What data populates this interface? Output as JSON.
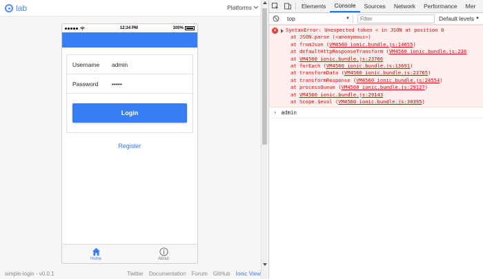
{
  "lab": {
    "logo_text": "lab",
    "platforms_label": "Platforms",
    "footer": {
      "version": "simple-login - v0.0.1",
      "links": [
        "Twitter",
        "Documentation",
        "Forum",
        "GitHub",
        "Ionic View"
      ]
    }
  },
  "phone": {
    "status": {
      "time": "12:34 PM",
      "battery": "100%"
    },
    "form": {
      "username_label": "Username",
      "username_value": "admin",
      "password_label": "Password",
      "password_value": "admin",
      "login_label": "Login",
      "register_label": "Register"
    },
    "tabs": [
      {
        "label": "Home",
        "icon": "home-icon",
        "active": true
      },
      {
        "label": "About",
        "icon": "info-icon",
        "active": false
      }
    ],
    "colors": {
      "primary": "#387ef5"
    }
  },
  "devtools": {
    "tabs": [
      "Elements",
      "Console",
      "Sources",
      "Network",
      "Performance",
      "Mer"
    ],
    "active_tab": "Console",
    "context": "top",
    "filter_placeholder": "Filter",
    "levels_label": "Default levels",
    "error": {
      "message": "SyntaxError: Unexpected token < in JSON at position 0",
      "frames": [
        {
          "fn": "at JSON.parse (<anonymous>)",
          "loc": ""
        },
        {
          "fn": "at fromJson (",
          "loc": "VM4560 ionic.bundle.js:14655",
          "tail": ")"
        },
        {
          "fn": "at defaultHttpResponseTransform (",
          "loc": "VM4560 ionic.bundle.js:236",
          "tail": ""
        },
        {
          "fn": "at ",
          "loc": "VM4560 ionic.bundle.js:23766",
          "tail": ""
        },
        {
          "fn": "at forEach (",
          "loc": "VM4560 ionic.bundle.js:13691",
          "tail": ")"
        },
        {
          "fn": "at transformData (",
          "loc": "VM4560 ionic.bundle.js:23765",
          "tail": ")"
        },
        {
          "fn": "at transformResponse (",
          "loc": "VM4560 ionic.bundle.js:24554",
          "tail": ")"
        },
        {
          "fn": "at processQueue (",
          "loc": "VM4560 ionic.bundle.js:29127",
          "tail": ")"
        },
        {
          "fn": "at ",
          "loc": "VM4560 ionic.bundle.js:29143",
          "tail": ""
        },
        {
          "fn": "at Scope.$eval (",
          "loc": "VM4560 ionic.bundle.js:30395",
          "tail": ")"
        }
      ]
    },
    "prompt_text": "admin"
  }
}
